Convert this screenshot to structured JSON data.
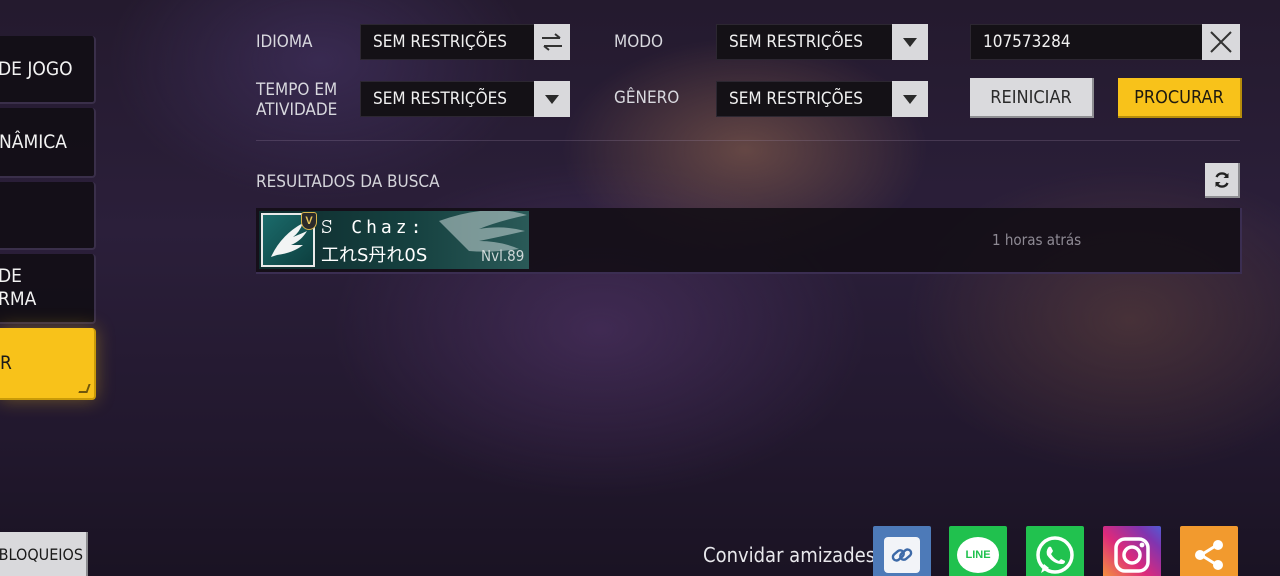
{
  "sidebar": {
    "items": [
      {
        "label": "DE JOGO",
        "active": false
      },
      {
        "label": "NÂMICA",
        "active": false
      },
      {
        "label": "",
        "active": false
      },
      {
        "label": "DE\nRMA",
        "active": false
      },
      {
        "label": "R",
        "active": true
      }
    ],
    "blocks_label": "BLOQUEIOS"
  },
  "filters": {
    "language": {
      "label": "IDIOMA",
      "value": "SEM RESTRIÇÕES",
      "icon": "swap-icon"
    },
    "mode": {
      "label": "MODO",
      "value": "SEM RESTRIÇÕES",
      "icon": "chevron-down-icon"
    },
    "search": {
      "value": "107573284",
      "icon": "close-icon"
    },
    "active_time": {
      "label": "TEMPO EM\nATIVIDADE",
      "value": "SEM RESTRIÇÕES",
      "icon": "chevron-down-icon"
    },
    "gender": {
      "label": "GÊNERO",
      "value": "SEM RESTRIÇÕES",
      "icon": "chevron-down-icon"
    }
  },
  "actions": {
    "reset_label": "REINICIAR",
    "search_label": "PROCURAR"
  },
  "results": {
    "title": "RESULTADOS DA BUSCA",
    "items": [
      {
        "name_top": "ꕶ Chaz꞉",
        "name_bottom": "工れS丹れ0S",
        "level": "Nvl.89",
        "badge": "V",
        "last_seen": "1 horas atrás"
      }
    ]
  },
  "invite": {
    "label": "Convidar amizades",
    "line_text": "LINE",
    "buttons": [
      {
        "name": "link",
        "color": "#4d7ab8"
      },
      {
        "name": "line",
        "color": "#20c14e"
      },
      {
        "name": "whatsapp",
        "color": "#21c24f"
      },
      {
        "name": "instagram",
        "color": "#b8339a"
      },
      {
        "name": "share",
        "color": "#f29a2e"
      }
    ]
  },
  "colors": {
    "accent": "#f8c21a",
    "panel": "#141116"
  }
}
